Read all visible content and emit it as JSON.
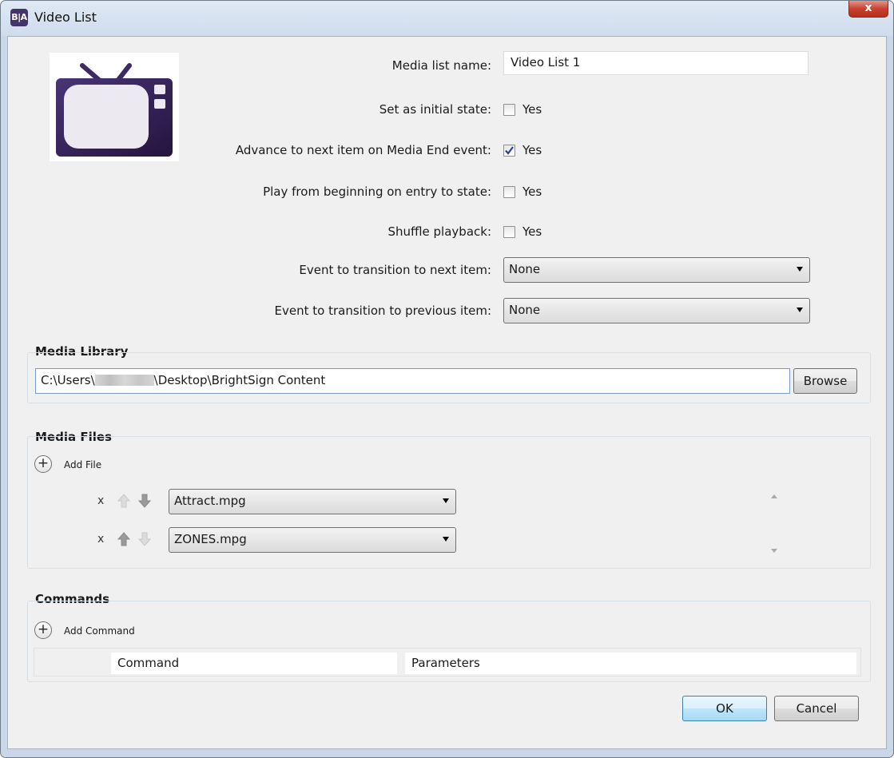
{
  "window": {
    "title": "Video List",
    "app_icon_text": "B|A",
    "close_glyph": "x"
  },
  "form": {
    "media_list_name_label": "Media list name:",
    "media_list_name_value": "Video List 1",
    "initial_state_label": "Set as initial state:",
    "initial_state_checked": false,
    "advance_label": "Advance to next item on Media End event:",
    "advance_checked": true,
    "play_from_beginning_label": "Play from beginning on entry to state:",
    "play_from_beginning_checked": false,
    "shuffle_label": "Shuffle playback:",
    "shuffle_checked": false,
    "yes_label": "Yes",
    "next_event_label": "Event to transition to next item:",
    "next_event_value": "None",
    "prev_event_label": "Event to transition to previous item:",
    "prev_event_value": "None"
  },
  "media_library": {
    "title": "Media Library",
    "path_prefix": "C:\\Users\\",
    "path_suffix": "\\Desktop\\BrightSign Content",
    "browse_label": "Browse"
  },
  "media_files": {
    "title": "Media Files",
    "add_label": "Add File",
    "remove_glyph": "x",
    "files": [
      {
        "name": "Attract.mpg"
      },
      {
        "name": "ZONES.mpg"
      }
    ]
  },
  "commands": {
    "title": "Commands",
    "add_label": "Add Command",
    "columns": [
      "Command",
      "Parameters"
    ]
  },
  "footer": {
    "ok_label": "OK",
    "cancel_label": "Cancel"
  },
  "colors": {
    "tv_purple": "#3b2a63",
    "tv_screen": "#ede9f1",
    "app_icon": "#43336b",
    "ok_border": "#3c7fb1"
  }
}
